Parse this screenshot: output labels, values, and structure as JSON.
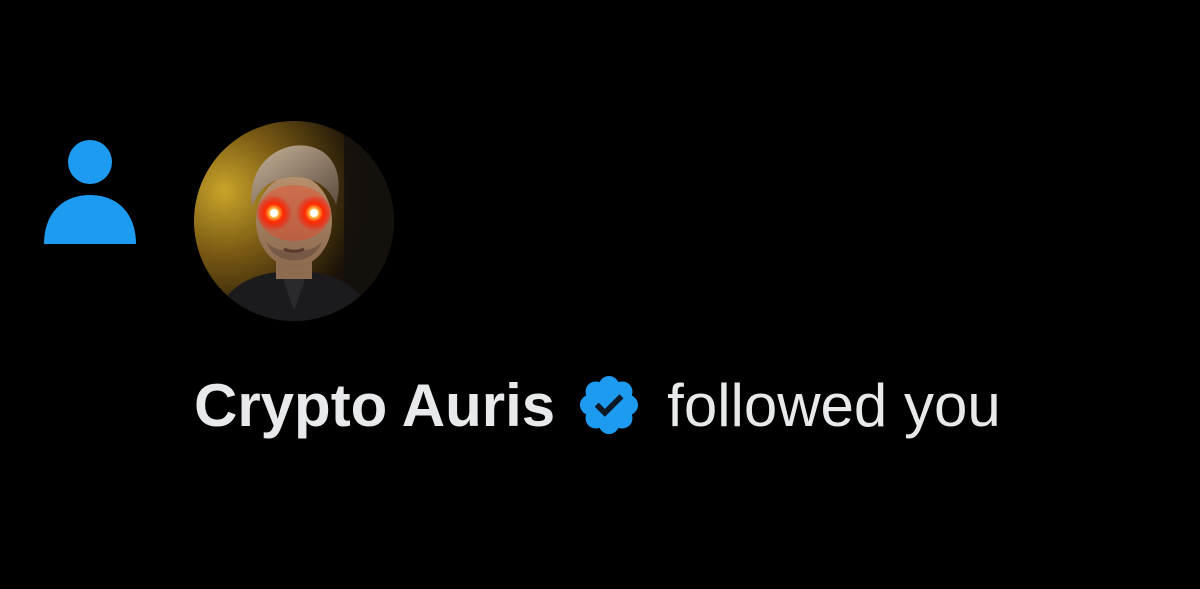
{
  "notification": {
    "type_icon": "person-icon",
    "avatar_icon": "profile-photo",
    "user_name": "Crypto Auris",
    "verified_icon": "verified-badge-icon",
    "action_text": "followed you"
  },
  "colors": {
    "background": "#000000",
    "accent": "#1D9BF0",
    "text": "#E7E9EA"
  }
}
